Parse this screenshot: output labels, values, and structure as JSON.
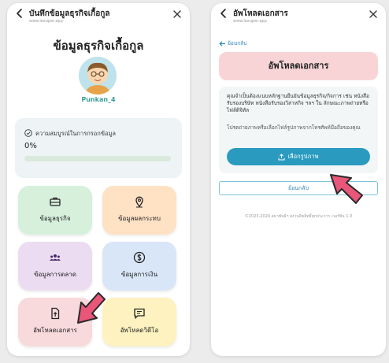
{
  "left_screen": {
    "header": {
      "title": "บันทึกข้อมูลธุรกิจเกื้อกูล",
      "url": "www.lexuper.app"
    },
    "page_title": "ข้อมูลธุรกิจเกื้อกูล",
    "username": "Punkan_4",
    "completeness": {
      "label": "ความสมบูรณ์ในการกรอกข้อมูล",
      "value_text": "0%",
      "progress_fraction": 0
    },
    "tiles": [
      {
        "label": "ข้อมูลธุรกิจ",
        "icon": "briefcase-icon"
      },
      {
        "label": "ข้อมูลผลกระทบ",
        "icon": "map-pin-icon"
      },
      {
        "label": "ข้อมูลการตลาด",
        "icon": "users-icon"
      },
      {
        "label": "ข้อมูลการเงิน",
        "icon": "dollar-icon"
      },
      {
        "label": "อัพโหลดเอกสาร",
        "icon": "file-upload-icon"
      },
      {
        "label": "อัพโหลดวิดีโอ",
        "icon": "video-message-icon"
      }
    ]
  },
  "right_screen": {
    "header": {
      "title": "อัพโหลดเอกสาร",
      "url": "www.lexuper.app"
    },
    "back_link": "ย้อนกลับ",
    "upload_title": "อัพโหลดเอกสาร",
    "description": "คุณจำเป็นต้องแนบหลักฐานยืนยันข้อมูลธุรกิจ/กิจการ เช่น หนังสือรับรองบริษัท หนังสือรับรองวิสาหกิจ ฯลฯ ใน ลักษณะภาพถ่ายหรือไฟล์ดิจิทัล",
    "hint": "โปรดถ่ายภาพหรือเลือกไฟล์รูปภาพจากโทรศัพท์มือถือของคุณ",
    "choose_button": "เลือกรูปภาพ",
    "back_button": "ย้อนกลับ",
    "footer": "©2023-2024 สมาพันธ์ฯ สงวนลิขสิทธิ์ทุกประการ เวอร์ชัน 1.0"
  },
  "colors": {
    "accent": "#2a9bbf",
    "progress": "#6bb07a",
    "username": "#3a9e9a",
    "cursor": "#e8567a"
  }
}
